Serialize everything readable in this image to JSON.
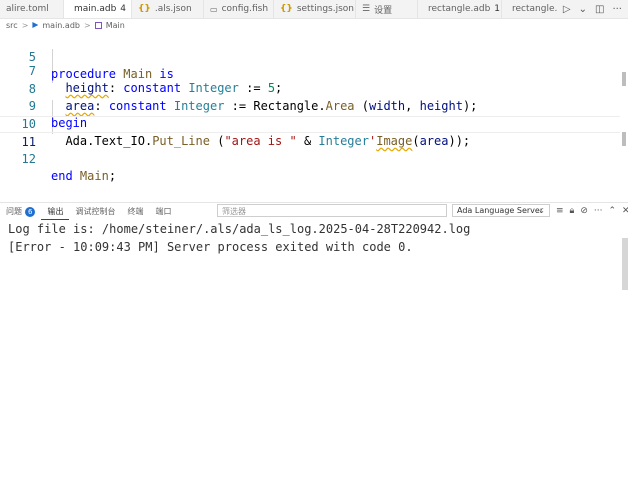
{
  "tabs": [
    {
      "label": "alire.toml",
      "kind": "toml"
    },
    {
      "label": "main.adb",
      "badge": "4",
      "modified": true,
      "active": true,
      "kind": "ada"
    },
    {
      "label": ".als.json",
      "kind": "json"
    },
    {
      "label": "config.fish",
      "kind": "file"
    },
    {
      "label": "settings.json",
      "kind": "json"
    },
    {
      "label": "设置",
      "kind": "settings"
    },
    {
      "label": "rectangle.adb",
      "badge": "1",
      "kind": "ada"
    },
    {
      "label": "rectangle.ads",
      "kind": "ada"
    }
  ],
  "breadcrumb": {
    "folder": "src",
    "file": "main.adb",
    "symbol": "Main",
    "sep": ">"
  },
  "editor": {
    "line_numbers": [
      "5",
      "7",
      "8",
      "9",
      "10",
      "11",
      "12"
    ],
    "l5": {
      "kw1": "procedure",
      "name": "Main",
      "kw2": "is"
    },
    "l7": {
      "id": "height",
      "colon": ":",
      "kw": "constant",
      "type": "Integer",
      "op": ":=",
      "num": "5",
      "semi": ";"
    },
    "l8": {
      "id": "area",
      "colon": ":",
      "kw": "constant",
      "type": "Integer",
      "op": ":=",
      "obj": "Rectangle",
      "dot": ".",
      "fn": "Area",
      "open": "(",
      "a1": "width",
      "comma": ",",
      "a2": "height",
      "close": ");"
    },
    "l9": {
      "kw": "begin"
    },
    "l10": {
      "pkg": "Ada",
      "d1": ".",
      "pkg2": "Text_IO",
      "d2": ".",
      "fn": "Put_Line",
      "open": "(",
      "str": "\"area is \"",
      "amp": "&",
      "type": "Integer",
      "tick": "'",
      "attr": "Image",
      "open2": "(",
      "arg": "area",
      "close": "));"
    },
    "l12": {
      "kw": "end",
      "name": "Main",
      "semi": ";"
    }
  },
  "panel": {
    "tabs": [
      {
        "label": "问题",
        "badge": "6"
      },
      {
        "label": "输出",
        "active": true
      },
      {
        "label": "调试控制台"
      },
      {
        "label": "终端"
      },
      {
        "label": "端口"
      }
    ],
    "filter_placeholder": "筛选器",
    "channel": "Ada Language Server"
  },
  "output_lines": [
    "Log file is: /home/steiner/.als/ada_ls_log.2025-04-28T220942.log",
    "[Error - 10:09:43 PM] Server process exited with code 0."
  ],
  "icons": {
    "tab_actions": [
      "run-icon",
      "chevron-down-icon",
      "split-editor-icon",
      "more-icon"
    ],
    "panel_actions": [
      "list-icon",
      "lock-icon",
      "clear-icon",
      "more-icon",
      "chevron-up-icon",
      "close-icon"
    ]
  },
  "colors": {
    "accent": "#1f6fd0",
    "keyword": "#0000ff",
    "type": "#267f99",
    "string": "#a31515",
    "number": "#098658",
    "function": "#795e26"
  }
}
